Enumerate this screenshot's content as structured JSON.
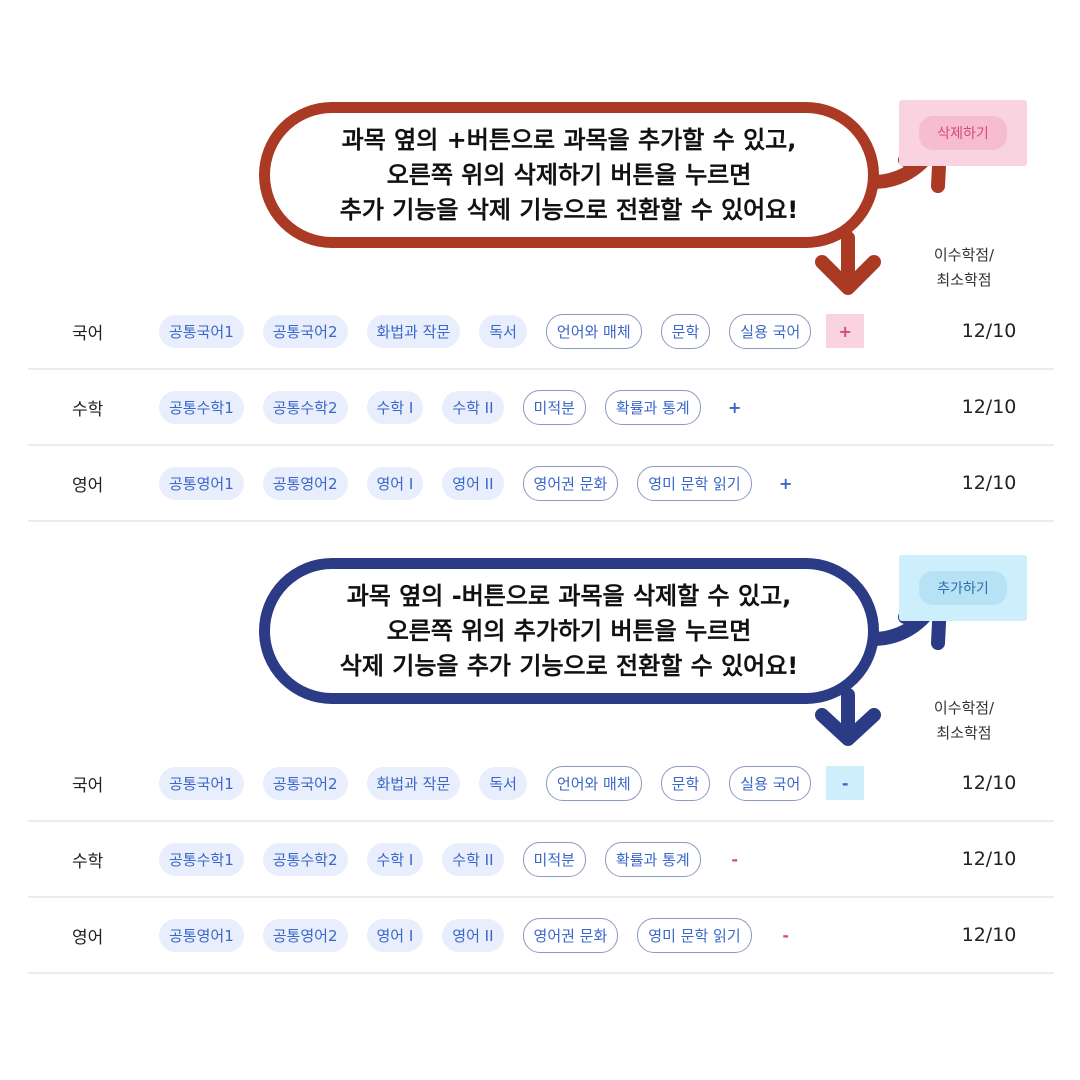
{
  "top": {
    "callout_lines": [
      "과목 옆의 +버튼으로 과목을 추가할 수 있고,",
      "오른쪽 위의 삭제하기 버튼을 누르면",
      "추가 기능을 삭제 기능으로 전환할 수 있어요!"
    ],
    "mode_button_label": "삭제하기",
    "credit_header": [
      "이수학점/",
      "최소학점"
    ],
    "toggle_symbol": "+",
    "rows": [
      {
        "subject": "국어",
        "credits": "12/10",
        "chips": [
          {
            "label": "공통국어1",
            "style": "filled"
          },
          {
            "label": "공통국어2",
            "style": "filled"
          },
          {
            "label": "화법과 작문",
            "style": "filled"
          },
          {
            "label": "독서",
            "style": "filled"
          },
          {
            "label": "언어와 매체",
            "style": "outlined"
          },
          {
            "label": "문학",
            "style": "outlined"
          },
          {
            "label": "실용 국어",
            "style": "outlined"
          }
        ]
      },
      {
        "subject": "수학",
        "credits": "12/10",
        "chips": [
          {
            "label": "공통수학1",
            "style": "filled"
          },
          {
            "label": "공통수학2",
            "style": "filled"
          },
          {
            "label": "수학 I",
            "style": "filled"
          },
          {
            "label": "수학 II",
            "style": "filled"
          },
          {
            "label": "미적분",
            "style": "outlined"
          },
          {
            "label": "확률과 통계",
            "style": "outlined"
          }
        ]
      },
      {
        "subject": "영어",
        "credits": "12/10",
        "chips": [
          {
            "label": "공통영어1",
            "style": "filled"
          },
          {
            "label": "공통영어2",
            "style": "filled"
          },
          {
            "label": "영어 I",
            "style": "filled"
          },
          {
            "label": "영어 II",
            "style": "filled"
          },
          {
            "label": "영어권 문화",
            "style": "outlined"
          },
          {
            "label": "영미 문학 읽기",
            "style": "outlined"
          }
        ]
      }
    ]
  },
  "bottom": {
    "callout_lines": [
      "과목 옆의 -버튼으로 과목을 삭제할 수 있고,",
      "오른쪽 위의 추가하기 버튼을 누르면",
      "삭제 기능을 추가 기능으로 전환할 수 있어요!"
    ],
    "mode_button_label": "추가하기",
    "credit_header": [
      "이수학점/",
      "최소학점"
    ],
    "toggle_symbol": "-",
    "rows": [
      {
        "subject": "국어",
        "credits": "12/10",
        "chips": [
          {
            "label": "공통국어1",
            "style": "filled"
          },
          {
            "label": "공통국어2",
            "style": "filled"
          },
          {
            "label": "화법과 작문",
            "style": "filled"
          },
          {
            "label": "독서",
            "style": "filled"
          },
          {
            "label": "언어와 매체",
            "style": "outlined"
          },
          {
            "label": "문학",
            "style": "outlined"
          },
          {
            "label": "실용 국어",
            "style": "outlined"
          }
        ]
      },
      {
        "subject": "수학",
        "credits": "12/10",
        "chips": [
          {
            "label": "공통수학1",
            "style": "filled"
          },
          {
            "label": "공통수학2",
            "style": "filled"
          },
          {
            "label": "수학 I",
            "style": "filled"
          },
          {
            "label": "수학 II",
            "style": "filled"
          },
          {
            "label": "미적분",
            "style": "outlined"
          },
          {
            "label": "확률과 통계",
            "style": "outlined"
          }
        ]
      },
      {
        "subject": "영어",
        "credits": "12/10",
        "chips": [
          {
            "label": "공통영어1",
            "style": "filled"
          },
          {
            "label": "공통영어2",
            "style": "filled"
          },
          {
            "label": "영어 I",
            "style": "filled"
          },
          {
            "label": "영어 II",
            "style": "filled"
          },
          {
            "label": "영어권 문화",
            "style": "outlined"
          },
          {
            "label": "영미 문학 읽기",
            "style": "outlined"
          }
        ]
      }
    ]
  },
  "colors": {
    "callout_top_border": "#ab3a24",
    "callout_bottom_border": "#2c3b86",
    "chip_text": "#3a67c9",
    "chip_fill": "#e8eefb",
    "minus_color": "#d94a7a",
    "delete_highlight": "#f9d3e0",
    "add_highlight": "#cdeefb"
  }
}
